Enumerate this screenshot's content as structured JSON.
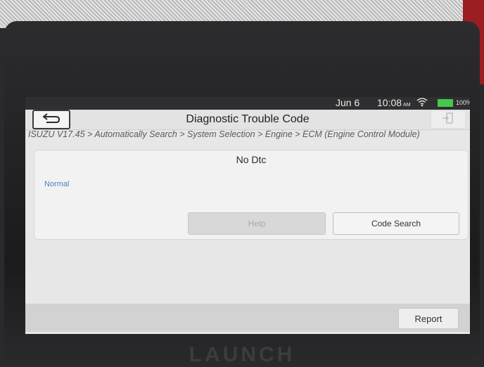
{
  "status_bar": {
    "date": "Jun 6",
    "time": "10:08",
    "ampm": "AM",
    "battery": "100%",
    "battery_level": 1.0
  },
  "header": {
    "title": "Diagnostic Trouble Code",
    "back_icon": "back-arrow-icon",
    "exit_icon": "exit-door-icon"
  },
  "breadcrumb": "ISUZU V17.45 > Automatically Search > System Selection > Engine > ECM (Engine Control Module)",
  "result_card": {
    "header": "No Dtc",
    "status": "Normal",
    "help_label": "Help",
    "code_search_label": "Code Search"
  },
  "footer": {
    "report_label": "Report"
  },
  "device": {
    "brand": "LAUNCH"
  },
  "colors": {
    "accent_blue": "#4b7fc6",
    "battery_green": "#46c94b",
    "screen_bg": "#e7e7e7"
  }
}
